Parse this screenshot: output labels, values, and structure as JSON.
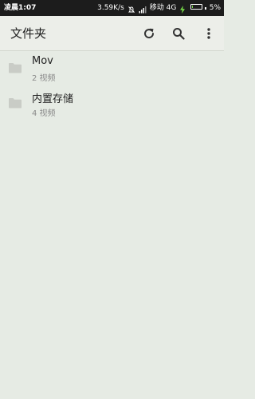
{
  "status_bar": {
    "time": "凌晨1:07",
    "network_speed": "3.59K/s",
    "carrier": "移动 4G",
    "battery_percent": "5%",
    "battery_level": 0.05,
    "icons": [
      "alarm-off-icon",
      "signal-icon",
      "battery-icon"
    ]
  },
  "app_bar": {
    "title": "文件夹",
    "actions": [
      "refresh-icon",
      "search-icon",
      "more-vert-icon"
    ]
  },
  "folders": [
    {
      "name": "Mov",
      "count": "2 视频"
    },
    {
      "name": "内置存储",
      "count": "4 视频"
    }
  ],
  "colors": {
    "status_bar_bg": "#1c1c1c",
    "app_bar_bg": "#eceee9",
    "background": "#e6ebe4",
    "folder_icon": "#c9ccc6",
    "battery_fill": "#7ae04a"
  }
}
